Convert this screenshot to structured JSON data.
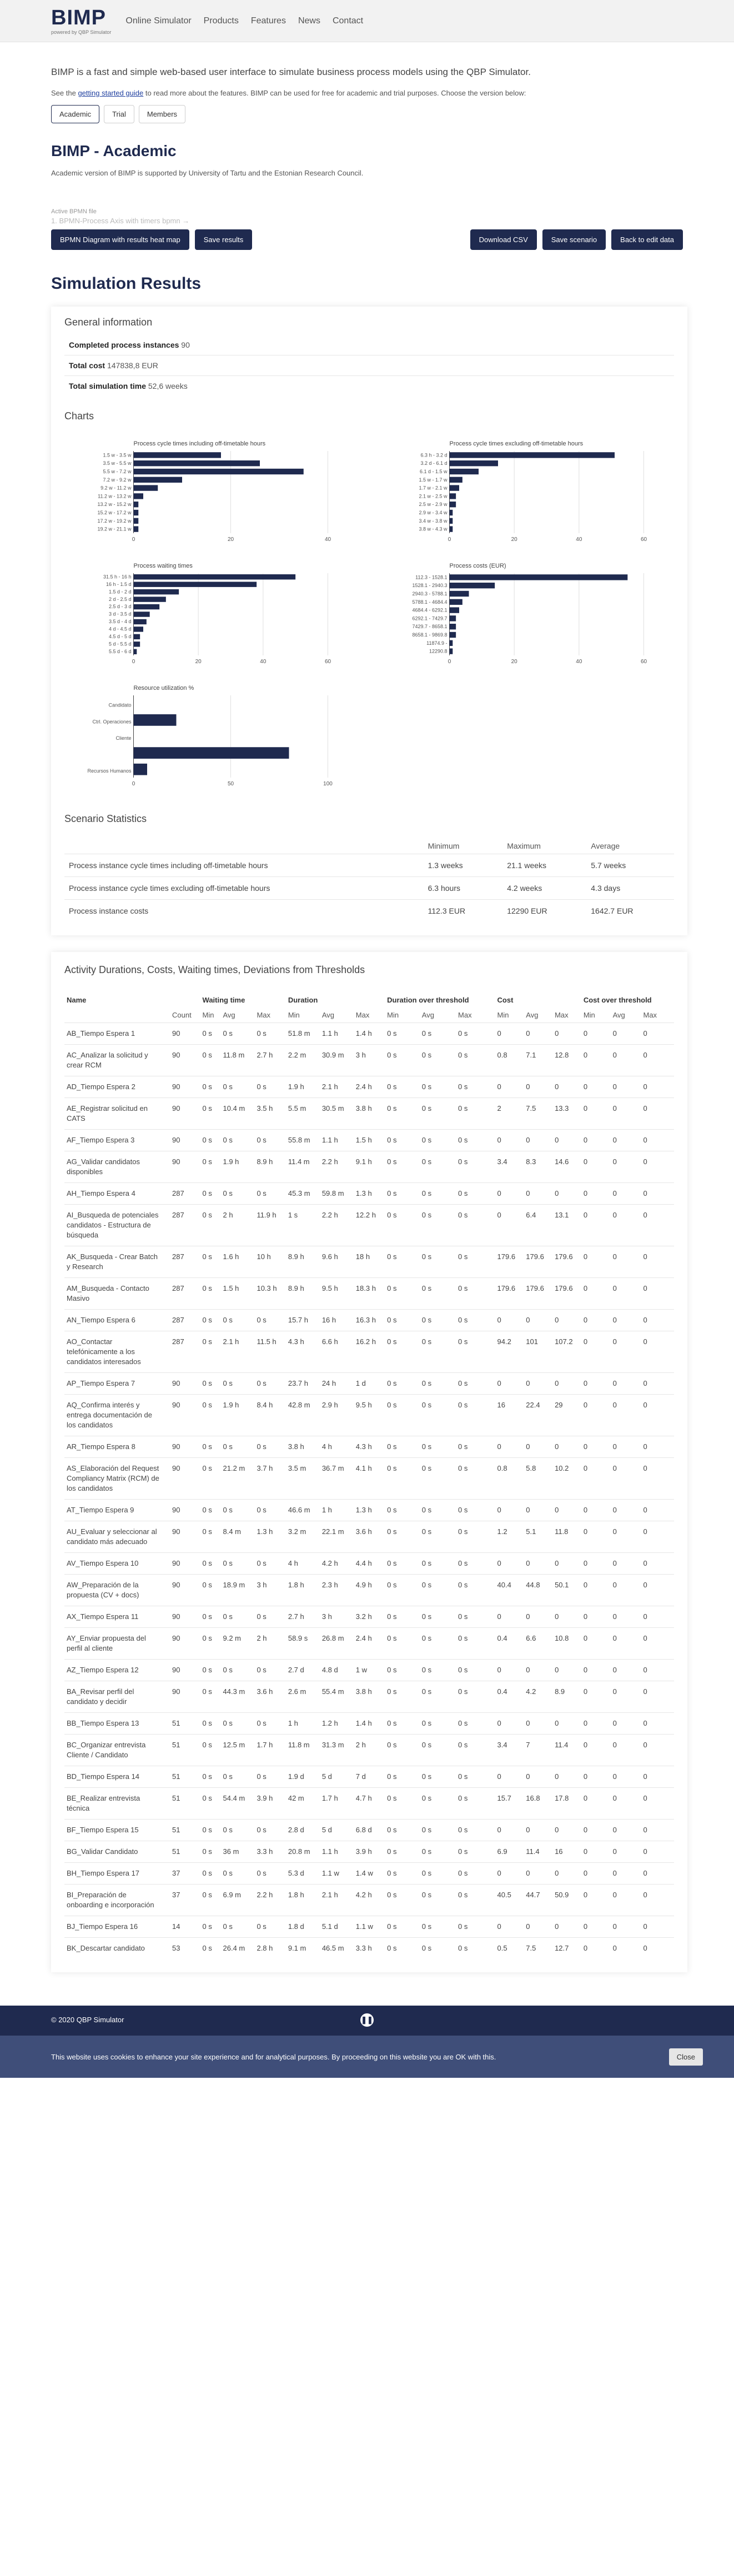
{
  "nav": {
    "logo": "BIMP",
    "logo_sub": "powered by QBP Simulator",
    "links": [
      "Online Simulator",
      "Products",
      "Features",
      "News",
      "Contact"
    ]
  },
  "intro": {
    "headline": "BIMP is a fast and simple web-based user interface to simulate business process models using the QBP Simulator.",
    "text_before": "See the ",
    "guide_link": "getting started guide",
    "text_after": " to read more about the features. BIMP can be used for free for academic and trial purposes. Choose the version below:",
    "versions": [
      "Academic",
      "Trial",
      "Members"
    ]
  },
  "academic": {
    "title": "BIMP - Academic",
    "note": "Academic version of BIMP is supported by University of Tartu and the Estonian Research Council."
  },
  "file": {
    "label": "Active BPMN file",
    "value": "1. BPMN-Process Axis with timers bpmn →"
  },
  "buttons": {
    "heatmap": "BPMN Diagram with results heat map",
    "save": "Save results",
    "csv": "Download CSV",
    "scenario": "Save scenario",
    "back": "Back to edit data"
  },
  "results_title": "Simulation Results",
  "general": {
    "title": "General information",
    "rows": [
      {
        "label": "Completed process instances",
        "value": "90"
      },
      {
        "label": "Total cost",
        "value": "147838,8 EUR"
      },
      {
        "label": "Total simulation time",
        "value": "52,6 weeks"
      }
    ]
  },
  "charts_title": "Charts",
  "chart_data": [
    {
      "type": "bar",
      "title": "Process cycle times including off-timetable hours",
      "categories": [
        "1.5 w - 3.5 w",
        "3.5 w - 5.5 w",
        "5.5 w - 7.2 w",
        "7.2 w - 9.2 w",
        "9.2 w - 11.2 w",
        "11.2 w - 13.2 w",
        "13.2 w - 15.2 w",
        "15.2 w - 17.2 w",
        "17.2 w - 19.2 w",
        "19.2 w - 21.1 w"
      ],
      "values": [
        18,
        26,
        35,
        10,
        5,
        2,
        1,
        1,
        1,
        1
      ],
      "xlim": [
        0,
        40
      ],
      "ticks": [
        0,
        20,
        40
      ]
    },
    {
      "type": "bar",
      "title": "Process cycle times excluding off-timetable hours",
      "categories": [
        "6.3 h - 3.2 d",
        "3.2 d - 6.1 d",
        "6.1 d - 1.5 w",
        "1.5 w - 1.7 w",
        "1.7 w - 2.1 w",
        "2.1 w - 2.5 w",
        "2.5 w - 2.9 w",
        "2.9 w - 3.4 w",
        "3.4 w - 3.8 w",
        "3.8 w - 4.3 w"
      ],
      "values": [
        51,
        15,
        9,
        4,
        3,
        2,
        2,
        1,
        1,
        1
      ],
      "xlim": [
        0,
        60
      ],
      "ticks": [
        0,
        20,
        40,
        60
      ]
    },
    {
      "type": "bar",
      "title": "Process waiting times",
      "categories": [
        "31.5 h - 16 h",
        "16 h - 1.5 d",
        "1.5 d - 2 d",
        "2 d - 2.5 d",
        "2.5 d - 3 d",
        "3 d - 3.5 d",
        "3.5 d - 4 d",
        "4 d - 4.5 d",
        "4.5 d - 5 d",
        "5 d - 5.5 d",
        "5.5 d - 6 d"
      ],
      "values": [
        50,
        38,
        14,
        10,
        8,
        5,
        4,
        3,
        2,
        2,
        1
      ],
      "xlim": [
        0,
        60
      ],
      "ticks": [
        0,
        20,
        40,
        60
      ]
    },
    {
      "type": "bar",
      "title": "Process costs (EUR)",
      "categories": [
        "112.3 - 1528.1",
        "1528.1 - 2940.3",
        "2940.3 - 5788.1",
        "5788.1 - 4684.4",
        "4684.4 - 6292.1",
        "6292.1 - 7429.7",
        "7429.7 - 8658.1",
        "8658.1 - 9869.8",
        "11874.9 -",
        "12290.8"
      ],
      "values": [
        55,
        14,
        6,
        4,
        3,
        2,
        2,
        2,
        1,
        1
      ],
      "xlim": [
        0,
        60
      ],
      "ticks": [
        0,
        20,
        40,
        60
      ]
    },
    {
      "type": "bar",
      "title": "Resource utilization %",
      "categories": [
        "Candidato",
        "Ctrl. Operaciones",
        "Cliente",
        "",
        "Recursos Humanos"
      ],
      "values": [
        0,
        22,
        0,
        80,
        7
      ],
      "xlim": [
        0,
        100
      ],
      "ticks": [
        0,
        50,
        100
      ]
    }
  ],
  "stats": {
    "title": "Scenario Statistics",
    "headers": [
      "Minimum",
      "Maximum",
      "Average"
    ],
    "rows": [
      {
        "label": "Process instance cycle times including off-timetable hours",
        "min": "1.3 weeks",
        "max": "21.1 weeks",
        "avg": "5.7 weeks"
      },
      {
        "label": "Process instance cycle times excluding off-timetable hours",
        "min": "6.3 hours",
        "max": "4.2 weeks",
        "avg": "4.3 days"
      },
      {
        "label": "Process instance costs",
        "min": "112.3 EUR",
        "max": "12290 EUR",
        "avg": "1642.7 EUR"
      }
    ]
  },
  "activities": {
    "title": "Activity Durations, Costs, Waiting times, Deviations from Thresholds",
    "group_headers": [
      "Name",
      "Waiting time",
      "Duration",
      "Duration over threshold",
      "Cost",
      "Cost over threshold"
    ],
    "sub_headers": [
      "Count",
      "Min",
      "Avg",
      "Max",
      "Min",
      "Avg",
      "Max",
      "Min",
      "Avg",
      "Max",
      "Min",
      "Avg",
      "Max",
      "Min",
      "Avg",
      "Max"
    ],
    "rows": [
      [
        "AB_Tiempo Espera 1",
        "90",
        "0 s",
        "0 s",
        "0 s",
        "51.8 m",
        "1.1 h",
        "1.4 h",
        "0 s",
        "0 s",
        "0 s",
        "0",
        "0",
        "0",
        "0",
        "0",
        "0"
      ],
      [
        "AC_Analizar la solicitud y crear RCM",
        "90",
        "0 s",
        "11.8 m",
        "2.7 h",
        "2.2 m",
        "30.9 m",
        "3 h",
        "0 s",
        "0 s",
        "0 s",
        "0.8",
        "7.1",
        "12.8",
        "0",
        "0",
        "0"
      ],
      [
        "AD_Tiempo Espera 2",
        "90",
        "0 s",
        "0 s",
        "0 s",
        "1.9 h",
        "2.1 h",
        "2.4 h",
        "0 s",
        "0 s",
        "0 s",
        "0",
        "0",
        "0",
        "0",
        "0",
        "0"
      ],
      [
        "AE_Registrar solicitud en CATS",
        "90",
        "0 s",
        "10.4 m",
        "3.5 h",
        "5.5 m",
        "30.5 m",
        "3.8 h",
        "0 s",
        "0 s",
        "0 s",
        "2",
        "7.5",
        "13.3",
        "0",
        "0",
        "0"
      ],
      [
        "AF_Tiempo Espera 3",
        "90",
        "0 s",
        "0 s",
        "0 s",
        "55.8 m",
        "1.1 h",
        "1.5 h",
        "0 s",
        "0 s",
        "0 s",
        "0",
        "0",
        "0",
        "0",
        "0",
        "0"
      ],
      [
        "AG_Validar candidatos disponibles",
        "90",
        "0 s",
        "1.9 h",
        "8.9 h",
        "11.4 m",
        "2.2 h",
        "9.1 h",
        "0 s",
        "0 s",
        "0 s",
        "3.4",
        "8.3",
        "14.6",
        "0",
        "0",
        "0"
      ],
      [
        "AH_Tiempo Espera 4",
        "287",
        "0 s",
        "0 s",
        "0 s",
        "45.3 m",
        "59.8 m",
        "1.3 h",
        "0 s",
        "0 s",
        "0 s",
        "0",
        "0",
        "0",
        "0",
        "0",
        "0"
      ],
      [
        "AI_Busqueda de potenciales candidatos - Estructura de búsqueda",
        "287",
        "0 s",
        "2 h",
        "11.9 h",
        "1 s",
        "2.2 h",
        "12.2 h",
        "0 s",
        "0 s",
        "0 s",
        "0",
        "6.4",
        "13.1",
        "0",
        "0",
        "0"
      ],
      [
        "AK_Busqueda - Crear Batch y Research",
        "287",
        "0 s",
        "1.6 h",
        "10 h",
        "8.9 h",
        "9.6 h",
        "18 h",
        "0 s",
        "0 s",
        "0 s",
        "179.6",
        "179.6",
        "179.6",
        "0",
        "0",
        "0"
      ],
      [
        "AM_Busqueda - Contacto Masivo",
        "287",
        "0 s",
        "1.5 h",
        "10.3 h",
        "8.9 h",
        "9.5 h",
        "18.3 h",
        "0 s",
        "0 s",
        "0 s",
        "179.6",
        "179.6",
        "179.6",
        "0",
        "0",
        "0"
      ],
      [
        "AN_Tiempo Espera 6",
        "287",
        "0 s",
        "0 s",
        "0 s",
        "15.7 h",
        "16 h",
        "16.3 h",
        "0 s",
        "0 s",
        "0 s",
        "0",
        "0",
        "0",
        "0",
        "0",
        "0"
      ],
      [
        "AO_Contactar telefónicamente a los candidatos interesados",
        "287",
        "0 s",
        "2.1 h",
        "11.5 h",
        "4.3 h",
        "6.6 h",
        "16.2 h",
        "0 s",
        "0 s",
        "0 s",
        "94.2",
        "101",
        "107.2",
        "0",
        "0",
        "0"
      ],
      [
        "AP_Tiempo Espera 7",
        "90",
        "0 s",
        "0 s",
        "0 s",
        "23.7 h",
        "24 h",
        "1 d",
        "0 s",
        "0 s",
        "0 s",
        "0",
        "0",
        "0",
        "0",
        "0",
        "0"
      ],
      [
        "AQ_Confirma interés y entrega documentación de los candidatos",
        "90",
        "0 s",
        "1.9 h",
        "8.4 h",
        "42.8 m",
        "2.9 h",
        "9.5 h",
        "0 s",
        "0 s",
        "0 s",
        "16",
        "22.4",
        "29",
        "0",
        "0",
        "0"
      ],
      [
        "AR_Tiempo Espera 8",
        "90",
        "0 s",
        "0 s",
        "0 s",
        "3.8 h",
        "4 h",
        "4.3 h",
        "0 s",
        "0 s",
        "0 s",
        "0",
        "0",
        "0",
        "0",
        "0",
        "0"
      ],
      [
        "AS_Elaboración del Request Compliancy Matrix (RCM) de los candidatos",
        "90",
        "0 s",
        "21.2 m",
        "3.7 h",
        "3.5 m",
        "36.7 m",
        "4.1 h",
        "0 s",
        "0 s",
        "0 s",
        "0.8",
        "5.8",
        "10.2",
        "0",
        "0",
        "0"
      ],
      [
        "AT_Tiempo Espera 9",
        "90",
        "0 s",
        "0 s",
        "0 s",
        "46.6 m",
        "1 h",
        "1.3 h",
        "0 s",
        "0 s",
        "0 s",
        "0",
        "0",
        "0",
        "0",
        "0",
        "0"
      ],
      [
        "AU_Evaluar y seleccionar al candidato más adecuado",
        "90",
        "0 s",
        "8.4 m",
        "1.3 h",
        "3.2 m",
        "22.1 m",
        "3.6 h",
        "0 s",
        "0 s",
        "0 s",
        "1.2",
        "5.1",
        "11.8",
        "0",
        "0",
        "0"
      ],
      [
        "AV_Tiempo Espera 10",
        "90",
        "0 s",
        "0 s",
        "0 s",
        "4 h",
        "4.2 h",
        "4.4 h",
        "0 s",
        "0 s",
        "0 s",
        "0",
        "0",
        "0",
        "0",
        "0",
        "0"
      ],
      [
        "AW_Preparación de la propuesta (CV + docs)",
        "90",
        "0 s",
        "18.9 m",
        "3 h",
        "1.8 h",
        "2.3 h",
        "4.9 h",
        "0 s",
        "0 s",
        "0 s",
        "40.4",
        "44.8",
        "50.1",
        "0",
        "0",
        "0"
      ],
      [
        "AX_Tiempo Espera 11",
        "90",
        "0 s",
        "0 s",
        "0 s",
        "2.7 h",
        "3 h",
        "3.2 h",
        "0 s",
        "0 s",
        "0 s",
        "0",
        "0",
        "0",
        "0",
        "0",
        "0"
      ],
      [
        "AY_Enviar propuesta del perfil al cliente",
        "90",
        "0 s",
        "9.2 m",
        "2 h",
        "58.9 s",
        "26.8 m",
        "2.4 h",
        "0 s",
        "0 s",
        "0 s",
        "0.4",
        "6.6",
        "10.8",
        "0",
        "0",
        "0"
      ],
      [
        "AZ_Tiempo Espera 12",
        "90",
        "0 s",
        "0 s",
        "0 s",
        "2.7 d",
        "4.8 d",
        "1 w",
        "0 s",
        "0 s",
        "0 s",
        "0",
        "0",
        "0",
        "0",
        "0",
        "0"
      ],
      [
        "BA_Revisar perfil del candidato y decidir",
        "90",
        "0 s",
        "44.3 m",
        "3.6 h",
        "2.6 m",
        "55.4 m",
        "3.8 h",
        "0 s",
        "0 s",
        "0 s",
        "0.4",
        "4.2",
        "8.9",
        "0",
        "0",
        "0"
      ],
      [
        "BB_Tiempo Espera 13",
        "51",
        "0 s",
        "0 s",
        "0 s",
        "1 h",
        "1.2 h",
        "1.4 h",
        "0 s",
        "0 s",
        "0 s",
        "0",
        "0",
        "0",
        "0",
        "0",
        "0"
      ],
      [
        "BC_Organizar entrevista Cliente / Candidato",
        "51",
        "0 s",
        "12.5 m",
        "1.7 h",
        "11.8 m",
        "31.3 m",
        "2 h",
        "0 s",
        "0 s",
        "0 s",
        "3.4",
        "7",
        "11.4",
        "0",
        "0",
        "0"
      ],
      [
        "BD_Tiempo Espera 14",
        "51",
        "0 s",
        "0 s",
        "0 s",
        "1.9 d",
        "5 d",
        "7 d",
        "0 s",
        "0 s",
        "0 s",
        "0",
        "0",
        "0",
        "0",
        "0",
        "0"
      ],
      [
        "BE_Realizar entrevista técnica",
        "51",
        "0 s",
        "54.4 m",
        "3.9 h",
        "42 m",
        "1.7 h",
        "4.7 h",
        "0 s",
        "0 s",
        "0 s",
        "15.7",
        "16.8",
        "17.8",
        "0",
        "0",
        "0"
      ],
      [
        "BF_Tiempo Espera 15",
        "51",
        "0 s",
        "0 s",
        "0 s",
        "2.8 d",
        "5 d",
        "6.8 d",
        "0 s",
        "0 s",
        "0 s",
        "0",
        "0",
        "0",
        "0",
        "0",
        "0"
      ],
      [
        "BG_Validar Candidato",
        "51",
        "0 s",
        "36 m",
        "3.3 h",
        "20.8 m",
        "1.1 h",
        "3.9 h",
        "0 s",
        "0 s",
        "0 s",
        "6.9",
        "11.4",
        "16",
        "0",
        "0",
        "0"
      ],
      [
        "BH_Tiempo Espera 17",
        "37",
        "0 s",
        "0 s",
        "0 s",
        "5.3 d",
        "1.1 w",
        "1.4 w",
        "0 s",
        "0 s",
        "0 s",
        "0",
        "0",
        "0",
        "0",
        "0",
        "0"
      ],
      [
        "BI_Preparación de onboarding e incorporación",
        "37",
        "0 s",
        "6.9 m",
        "2.2 h",
        "1.8 h",
        "2.1 h",
        "4.2 h",
        "0 s",
        "0 s",
        "0 s",
        "40.5",
        "44.7",
        "50.9",
        "0",
        "0",
        "0"
      ],
      [
        "BJ_Tiempo Espera 16",
        "14",
        "0 s",
        "0 s",
        "0 s",
        "1.8 d",
        "5.1 d",
        "1.1 w",
        "0 s",
        "0 s",
        "0 s",
        "0",
        "0",
        "0",
        "0",
        "0",
        "0"
      ],
      [
        "BK_Descartar candidato",
        "53",
        "0 s",
        "26.4 m",
        "2.8 h",
        "9.1 m",
        "46.5 m",
        "3.3 h",
        "0 s",
        "0 s",
        "0 s",
        "0.5",
        "7.5",
        "12.7",
        "0",
        "0",
        "0"
      ]
    ]
  },
  "footer": {
    "copy": "© 2020 QBP Simulator",
    "cookie_text": "This website uses cookies to enhance your site experience and for analytical purposes. By proceeding on this website you are OK with this.",
    "close": "Close"
  }
}
